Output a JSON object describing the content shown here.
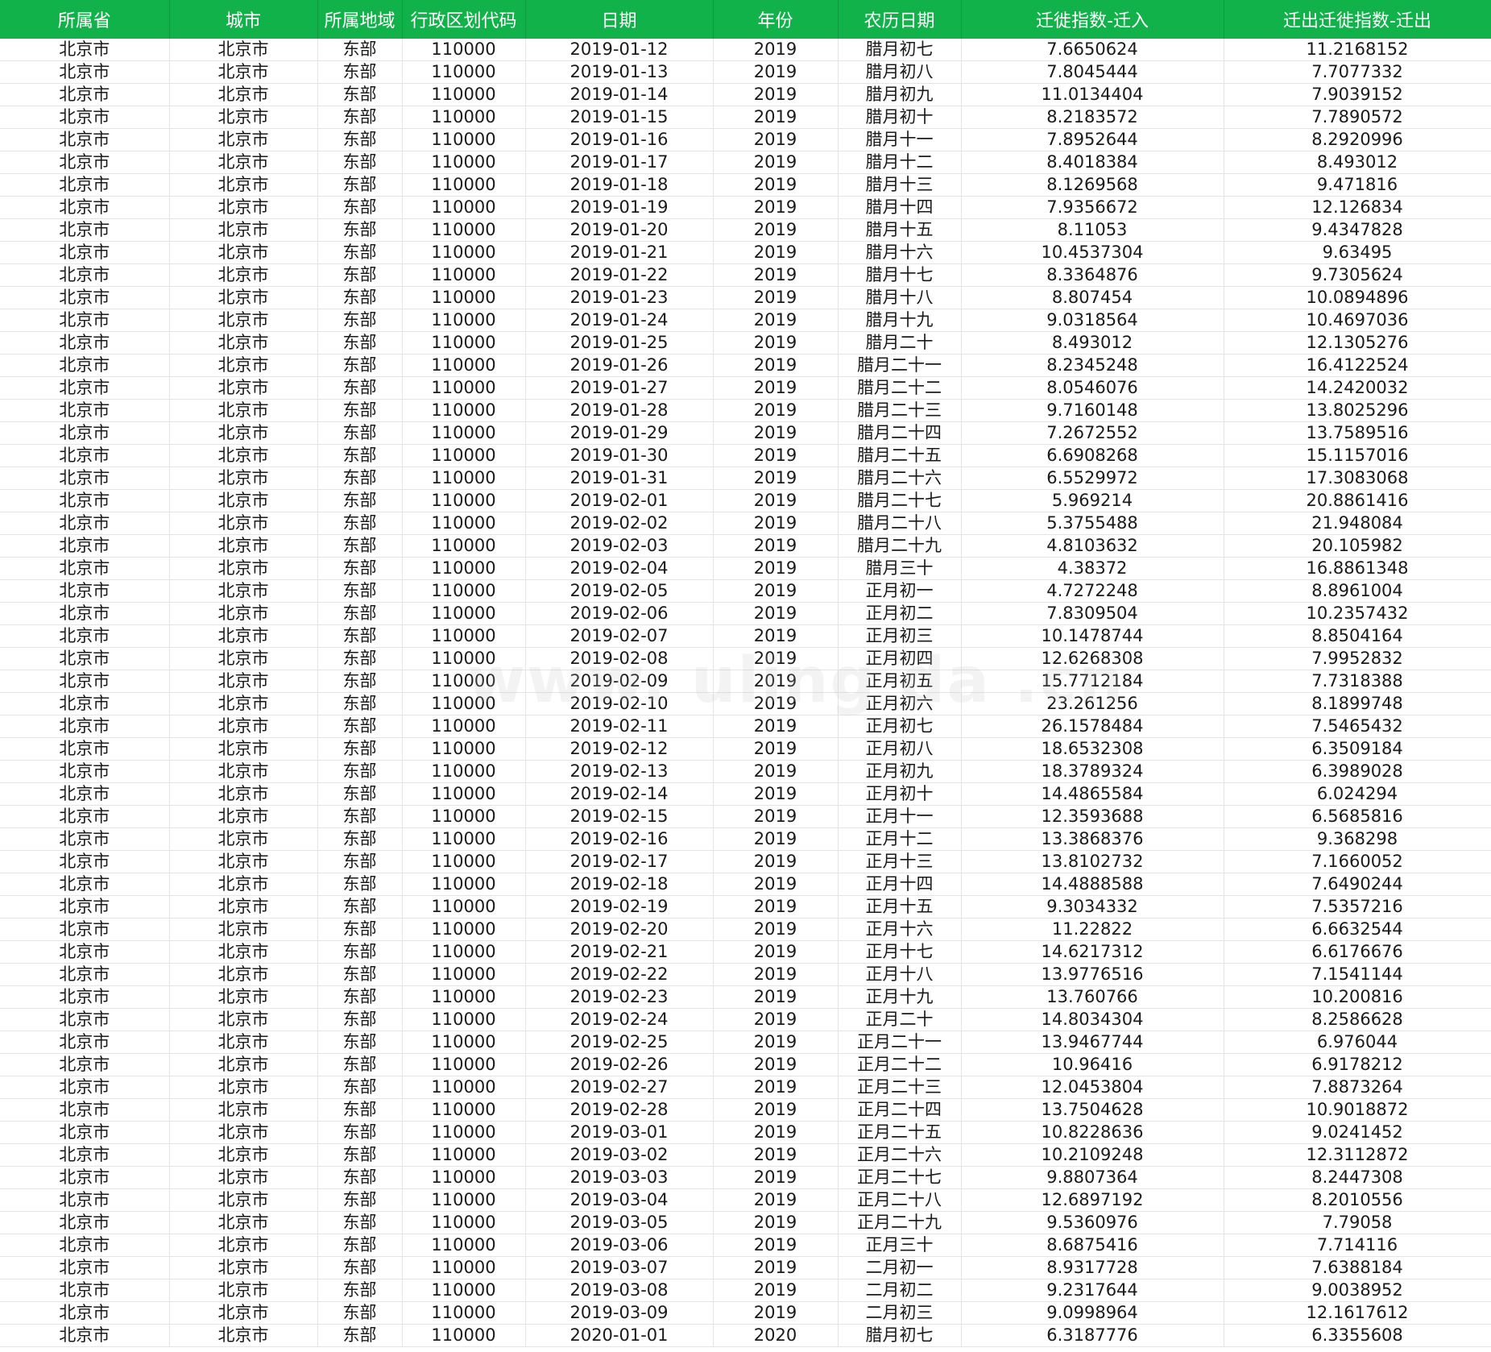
{
  "colors": {
    "header_bg": "#12b24a",
    "header_text": "#ffffff",
    "grid_line": "#e4e4e4"
  },
  "watermark": "www.  uling  da  .cn",
  "columns": [
    "所属省",
    "城市",
    "所属地域",
    "行政区划代码",
    "日期",
    "年份",
    "农历日期",
    "迁徙指数-迁入",
    "迁出迁徙指数-迁出"
  ],
  "rows": [
    [
      "北京市",
      "北京市",
      "东部",
      "110000",
      "2019-01-12",
      "2019",
      "腊月初七",
      "7.6650624",
      "11.2168152"
    ],
    [
      "北京市",
      "北京市",
      "东部",
      "110000",
      "2019-01-13",
      "2019",
      "腊月初八",
      "7.8045444",
      "7.7077332"
    ],
    [
      "北京市",
      "北京市",
      "东部",
      "110000",
      "2019-01-14",
      "2019",
      "腊月初九",
      "11.0134404",
      "7.9039152"
    ],
    [
      "北京市",
      "北京市",
      "东部",
      "110000",
      "2019-01-15",
      "2019",
      "腊月初十",
      "8.2183572",
      "7.7890572"
    ],
    [
      "北京市",
      "北京市",
      "东部",
      "110000",
      "2019-01-16",
      "2019",
      "腊月十一",
      "7.8952644",
      "8.2920996"
    ],
    [
      "北京市",
      "北京市",
      "东部",
      "110000",
      "2019-01-17",
      "2019",
      "腊月十二",
      "8.4018384",
      "8.493012"
    ],
    [
      "北京市",
      "北京市",
      "东部",
      "110000",
      "2019-01-18",
      "2019",
      "腊月十三",
      "8.1269568",
      "9.471816"
    ],
    [
      "北京市",
      "北京市",
      "东部",
      "110000",
      "2019-01-19",
      "2019",
      "腊月十四",
      "7.9356672",
      "12.126834"
    ],
    [
      "北京市",
      "北京市",
      "东部",
      "110000",
      "2019-01-20",
      "2019",
      "腊月十五",
      "8.11053",
      "9.4347828"
    ],
    [
      "北京市",
      "北京市",
      "东部",
      "110000",
      "2019-01-21",
      "2019",
      "腊月十六",
      "10.4537304",
      "9.63495"
    ],
    [
      "北京市",
      "北京市",
      "东部",
      "110000",
      "2019-01-22",
      "2019",
      "腊月十七",
      "8.3364876",
      "9.7305624"
    ],
    [
      "北京市",
      "北京市",
      "东部",
      "110000",
      "2019-01-23",
      "2019",
      "腊月十八",
      "8.807454",
      "10.0894896"
    ],
    [
      "北京市",
      "北京市",
      "东部",
      "110000",
      "2019-01-24",
      "2019",
      "腊月十九",
      "9.0318564",
      "10.4697036"
    ],
    [
      "北京市",
      "北京市",
      "东部",
      "110000",
      "2019-01-25",
      "2019",
      "腊月二十",
      "8.493012",
      "12.1305276"
    ],
    [
      "北京市",
      "北京市",
      "东部",
      "110000",
      "2019-01-26",
      "2019",
      "腊月二十一",
      "8.2345248",
      "16.4122524"
    ],
    [
      "北京市",
      "北京市",
      "东部",
      "110000",
      "2019-01-27",
      "2019",
      "腊月二十二",
      "8.0546076",
      "14.2420032"
    ],
    [
      "北京市",
      "北京市",
      "东部",
      "110000",
      "2019-01-28",
      "2019",
      "腊月二十三",
      "9.7160148",
      "13.8025296"
    ],
    [
      "北京市",
      "北京市",
      "东部",
      "110000",
      "2019-01-29",
      "2019",
      "腊月二十四",
      "7.2672552",
      "13.7589516"
    ],
    [
      "北京市",
      "北京市",
      "东部",
      "110000",
      "2019-01-30",
      "2019",
      "腊月二十五",
      "6.6908268",
      "15.1157016"
    ],
    [
      "北京市",
      "北京市",
      "东部",
      "110000",
      "2019-01-31",
      "2019",
      "腊月二十六",
      "6.5529972",
      "17.3083068"
    ],
    [
      "北京市",
      "北京市",
      "东部",
      "110000",
      "2019-02-01",
      "2019",
      "腊月二十七",
      "5.969214",
      "20.8861416"
    ],
    [
      "北京市",
      "北京市",
      "东部",
      "110000",
      "2019-02-02",
      "2019",
      "腊月二十八",
      "5.3755488",
      "21.948084"
    ],
    [
      "北京市",
      "北京市",
      "东部",
      "110000",
      "2019-02-03",
      "2019",
      "腊月二十九",
      "4.8103632",
      "20.105982"
    ],
    [
      "北京市",
      "北京市",
      "东部",
      "110000",
      "2019-02-04",
      "2019",
      "腊月三十",
      "4.38372",
      "16.8861348"
    ],
    [
      "北京市",
      "北京市",
      "东部",
      "110000",
      "2019-02-05",
      "2019",
      "正月初一",
      "4.7272248",
      "8.8961004"
    ],
    [
      "北京市",
      "北京市",
      "东部",
      "110000",
      "2019-02-06",
      "2019",
      "正月初二",
      "7.8309504",
      "10.2357432"
    ],
    [
      "北京市",
      "北京市",
      "东部",
      "110000",
      "2019-02-07",
      "2019",
      "正月初三",
      "10.1478744",
      "8.8504164"
    ],
    [
      "北京市",
      "北京市",
      "东部",
      "110000",
      "2019-02-08",
      "2019",
      "正月初四",
      "12.6268308",
      "7.9952832"
    ],
    [
      "北京市",
      "北京市",
      "东部",
      "110000",
      "2019-02-09",
      "2019",
      "正月初五",
      "15.7712184",
      "7.7318388"
    ],
    [
      "北京市",
      "北京市",
      "东部",
      "110000",
      "2019-02-10",
      "2019",
      "正月初六",
      "23.261256",
      "8.1899748"
    ],
    [
      "北京市",
      "北京市",
      "东部",
      "110000",
      "2019-02-11",
      "2019",
      "正月初七",
      "26.1578484",
      "7.5465432"
    ],
    [
      "北京市",
      "北京市",
      "东部",
      "110000",
      "2019-02-12",
      "2019",
      "正月初八",
      "18.6532308",
      "6.3509184"
    ],
    [
      "北京市",
      "北京市",
      "东部",
      "110000",
      "2019-02-13",
      "2019",
      "正月初九",
      "18.3789324",
      "6.3989028"
    ],
    [
      "北京市",
      "北京市",
      "东部",
      "110000",
      "2019-02-14",
      "2019",
      "正月初十",
      "14.4865584",
      "6.024294"
    ],
    [
      "北京市",
      "北京市",
      "东部",
      "110000",
      "2019-02-15",
      "2019",
      "正月十一",
      "12.3593688",
      "6.5685816"
    ],
    [
      "北京市",
      "北京市",
      "东部",
      "110000",
      "2019-02-16",
      "2019",
      "正月十二",
      "13.3868376",
      "9.368298"
    ],
    [
      "北京市",
      "北京市",
      "东部",
      "110000",
      "2019-02-17",
      "2019",
      "正月十三",
      "13.8102732",
      "7.1660052"
    ],
    [
      "北京市",
      "北京市",
      "东部",
      "110000",
      "2019-02-18",
      "2019",
      "正月十四",
      "14.4888588",
      "7.6490244"
    ],
    [
      "北京市",
      "北京市",
      "东部",
      "110000",
      "2019-02-19",
      "2019",
      "正月十五",
      "9.3034332",
      "7.5357216"
    ],
    [
      "北京市",
      "北京市",
      "东部",
      "110000",
      "2019-02-20",
      "2019",
      "正月十六",
      "11.22822",
      "6.6632544"
    ],
    [
      "北京市",
      "北京市",
      "东部",
      "110000",
      "2019-02-21",
      "2019",
      "正月十七",
      "14.6217312",
      "6.6176676"
    ],
    [
      "北京市",
      "北京市",
      "东部",
      "110000",
      "2019-02-22",
      "2019",
      "正月十八",
      "13.9776516",
      "7.1541144"
    ],
    [
      "北京市",
      "北京市",
      "东部",
      "110000",
      "2019-02-23",
      "2019",
      "正月十九",
      "13.760766",
      "10.200816"
    ],
    [
      "北京市",
      "北京市",
      "东部",
      "110000",
      "2019-02-24",
      "2019",
      "正月二十",
      "14.8034304",
      "8.2586628"
    ],
    [
      "北京市",
      "北京市",
      "东部",
      "110000",
      "2019-02-25",
      "2019",
      "正月二十一",
      "13.9467744",
      "6.976044"
    ],
    [
      "北京市",
      "北京市",
      "东部",
      "110000",
      "2019-02-26",
      "2019",
      "正月二十二",
      "10.96416",
      "6.9178212"
    ],
    [
      "北京市",
      "北京市",
      "东部",
      "110000",
      "2019-02-27",
      "2019",
      "正月二十三",
      "12.0453804",
      "7.8873264"
    ],
    [
      "北京市",
      "北京市",
      "东部",
      "110000",
      "2019-02-28",
      "2019",
      "正月二十四",
      "13.7504628",
      "10.9018872"
    ],
    [
      "北京市",
      "北京市",
      "东部",
      "110000",
      "2019-03-01",
      "2019",
      "正月二十五",
      "10.8228636",
      "9.0241452"
    ],
    [
      "北京市",
      "北京市",
      "东部",
      "110000",
      "2019-03-02",
      "2019",
      "正月二十六",
      "10.2109248",
      "12.3112872"
    ],
    [
      "北京市",
      "北京市",
      "东部",
      "110000",
      "2019-03-03",
      "2019",
      "正月二十七",
      "9.8807364",
      "8.2447308"
    ],
    [
      "北京市",
      "北京市",
      "东部",
      "110000",
      "2019-03-04",
      "2019",
      "正月二十八",
      "12.6897192",
      "8.2010556"
    ],
    [
      "北京市",
      "北京市",
      "东部",
      "110000",
      "2019-03-05",
      "2019",
      "正月二十九",
      "9.5360976",
      "7.79058"
    ],
    [
      "北京市",
      "北京市",
      "东部",
      "110000",
      "2019-03-06",
      "2019",
      "正月三十",
      "8.6875416",
      "7.714116"
    ],
    [
      "北京市",
      "北京市",
      "东部",
      "110000",
      "2019-03-07",
      "2019",
      "二月初一",
      "8.9317728",
      "7.6388184"
    ],
    [
      "北京市",
      "北京市",
      "东部",
      "110000",
      "2019-03-08",
      "2019",
      "二月初二",
      "9.2317644",
      "9.0038952"
    ],
    [
      "北京市",
      "北京市",
      "东部",
      "110000",
      "2019-03-09",
      "2019",
      "二月初三",
      "9.0998964",
      "12.1617612"
    ],
    [
      "北京市",
      "北京市",
      "东部",
      "110000",
      "2020-01-01",
      "2020",
      "腊月初七",
      "6.3187776",
      "6.3355608"
    ]
  ]
}
